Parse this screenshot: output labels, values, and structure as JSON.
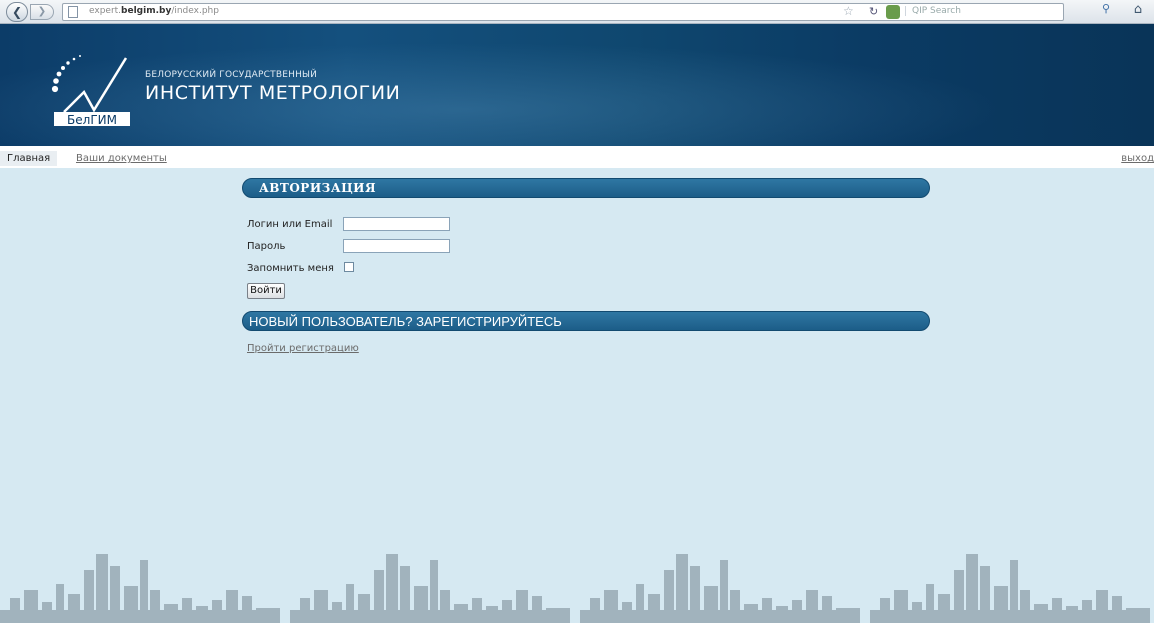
{
  "browser": {
    "url_prefix": "expert.",
    "url_domain": "belgim.by",
    "url_path": "/index.php",
    "search_placeholder": "QIP Search",
    "back_icon": "back-arrow-icon",
    "forward_icon": "forward-arrow-icon"
  },
  "header": {
    "org_line1": "БЕЛОРУССКИЙ ГОСУДАРСТВЕННЫЙ",
    "org_line2": "ИНСТИТУТ МЕТРОЛОГИИ",
    "logo_text": "БелГИМ"
  },
  "nav": {
    "home": "Главная",
    "docs": "Ваши документы",
    "exit": "выход"
  },
  "auth": {
    "title": "АВТОРИЗАЦИЯ",
    "login_label": "Логин или Email",
    "password_label": "Пароль",
    "remember_label": "Запомнить меня",
    "submit": "Войти",
    "login_value": "",
    "password_value": ""
  },
  "register": {
    "title": "НОВЫЙ ПОЛЬЗОВАТЕЛЬ? ЗАРЕГИСТРИРУЙТЕСЬ",
    "link": "Пройти регистрацию"
  },
  "colors": {
    "page_bg": "#d6e9f2",
    "banner_bg": "#0c3c68",
    "bar_bg": "#1c5d88"
  }
}
